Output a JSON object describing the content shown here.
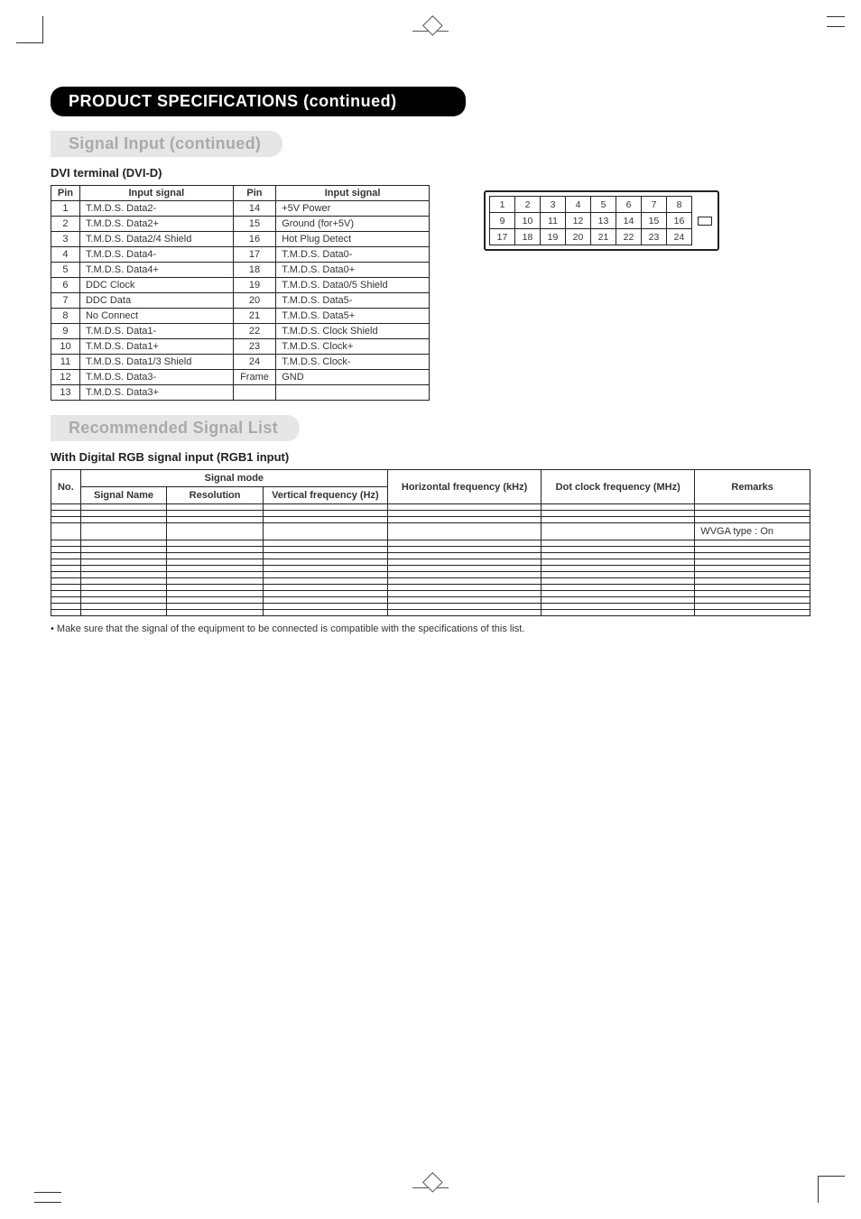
{
  "header": {
    "chapter": "PRODUCT SPECIFICATIONS (continued)"
  },
  "section1": {
    "title": "Signal Input (continued)",
    "sub": "DVI terminal (DVI-D)"
  },
  "pin_table": {
    "head_pin": "Pin",
    "head_sig": "Input signal",
    "rows": [
      {
        "p1": "1",
        "s1": "T.M.D.S. Data2-",
        "p2": "14",
        "s2": "+5V Power"
      },
      {
        "p1": "2",
        "s1": "T.M.D.S. Data2+",
        "p2": "15",
        "s2": "Ground (for+5V)"
      },
      {
        "p1": "3",
        "s1": "T.M.D.S. Data2/4 Shield",
        "p2": "16",
        "s2": "Hot Plug Detect"
      },
      {
        "p1": "4",
        "s1": "T.M.D.S. Data4-",
        "p2": "17",
        "s2": "T.M.D.S. Data0-"
      },
      {
        "p1": "5",
        "s1": "T.M.D.S. Data4+",
        "p2": "18",
        "s2": "T.M.D.S. Data0+"
      },
      {
        "p1": "6",
        "s1": "DDC Clock",
        "p2": "19",
        "s2": "T.M.D.S. Data0/5 Shield"
      },
      {
        "p1": "7",
        "s1": "DDC Data",
        "p2": "20",
        "s2": "T.M.D.S. Data5-"
      },
      {
        "p1": "8",
        "s1": "No Connect",
        "p2": "21",
        "s2": "T.M.D.S. Data5+"
      },
      {
        "p1": "9",
        "s1": "T.M.D.S. Data1-",
        "p2": "22",
        "s2": "T.M.D.S. Clock Shield"
      },
      {
        "p1": "10",
        "s1": "T.M.D.S. Data1+",
        "p2": "23",
        "s2": "T.M.D.S. Clock+"
      },
      {
        "p1": "11",
        "s1": "T.M.D.S. Data1/3 Shield",
        "p2": "24",
        "s2": "T.M.D.S. Clock-"
      },
      {
        "p1": "12",
        "s1": "T.M.D.S. Data3-",
        "p2": "Frame",
        "s2": "GND"
      },
      {
        "p1": "13",
        "s1": "T.M.D.S. Data3+",
        "p2": "",
        "s2": ""
      }
    ]
  },
  "connector": {
    "r1": [
      "1",
      "2",
      "3",
      "4",
      "5",
      "6",
      "7",
      "8"
    ],
    "r2": [
      "9",
      "10",
      "11",
      "12",
      "13",
      "14",
      "15",
      "16"
    ],
    "r3": [
      "17",
      "18",
      "19",
      "20",
      "21",
      "22",
      "23",
      "24"
    ]
  },
  "section2": {
    "title": "Recommended Signal List",
    "sub": "With Digital RGB signal input (RGB1 input)"
  },
  "sig_list": {
    "head": {
      "no": "No.",
      "mode": "Signal mode",
      "name": "Signal Name",
      "res": "Resolution",
      "vf": "Vertical frequency (Hz)",
      "hf": "Horizontal frequency (kHz)",
      "dot": "Dot clock frequency (MHz)",
      "rem": "Remarks"
    },
    "rows": [
      {
        "rem": ""
      },
      {
        "rem": ""
      },
      {
        "rem": ""
      },
      {
        "rem": "WVGA type : On"
      },
      {
        "rem": ""
      },
      {
        "rem": ""
      },
      {
        "rem": ""
      },
      {
        "rem": ""
      },
      {
        "rem": ""
      },
      {
        "rem": ""
      },
      {
        "rem": ""
      },
      {
        "rem": ""
      },
      {
        "rem": ""
      },
      {
        "rem": ""
      },
      {
        "rem": ""
      },
      {
        "rem": ""
      }
    ]
  },
  "note": "• Make sure that the signal of the equipment to be connected is compatible with the specifications of this list."
}
